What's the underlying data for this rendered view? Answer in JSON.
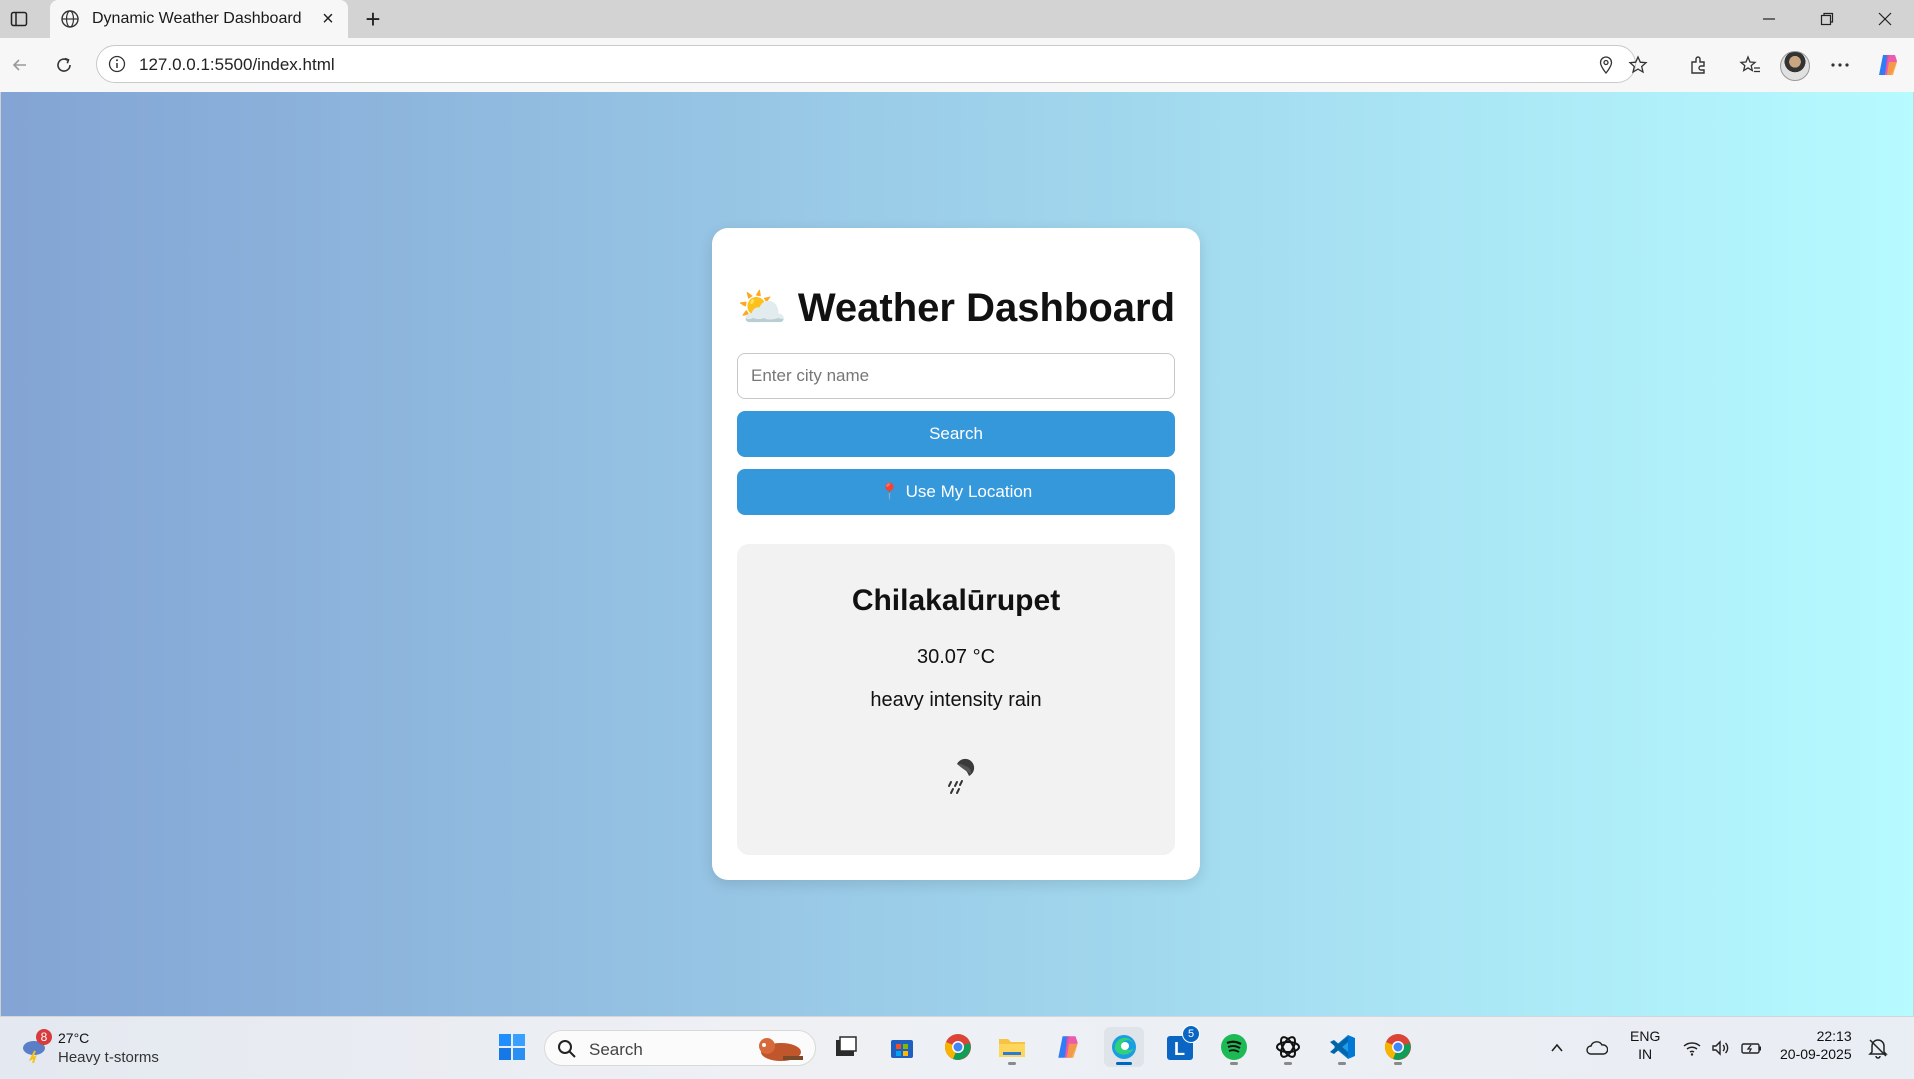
{
  "browser": {
    "tab_title": "Dynamic Weather Dashboard",
    "url": "127.0.0.1:5500/index.html"
  },
  "app": {
    "title": "⛅ Weather Dashboard",
    "search_placeholder": "Enter city name",
    "search_value": "",
    "search_button": "Search",
    "location_button_icon": "📍",
    "location_button": "Use My Location",
    "primary_color": "#3498db",
    "background_gradient": [
      "#83a4d4",
      "#b6fbff"
    ]
  },
  "weather": {
    "city": "Chilakalūrupet",
    "temperature": "30.07 °C",
    "description": "heavy intensity rain",
    "icon": "rain-cloud-icon"
  },
  "taskbar": {
    "weather_badge": "8",
    "weather_temp": "27°C",
    "weather_condition": "Heavy t-storms",
    "search_label": "Search",
    "lang_line1": "ENG",
    "lang_line2": "IN",
    "time": "22:13",
    "date": "20-09-2025",
    "linkedin_badge": "5"
  }
}
